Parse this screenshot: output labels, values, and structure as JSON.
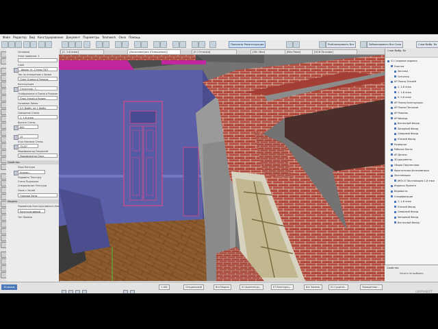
{
  "menu": [
    "Файл",
    "Редактор",
    "Вид",
    "Конструирование",
    "Документ",
    "Параметры",
    "Teamwork",
    "Окно",
    "Помощь"
  ],
  "toolbar": {
    "renovation_button": "Просмотр Реконструкции",
    "publish_button": "Разблокировать Все",
    "layer_button": "Заблокировать Все Слои",
    "find_select_button": "Слои Выбр. Бл"
  },
  "tabs": [
    {
      "label": "[1. 1-й этаж]",
      "active": false
    },
    {
      "label": "[Аксонометрия (Освещение)]",
      "active": true
    },
    {
      "label": "[0 / Отточка]",
      "active": false
    },
    {
      "label": "[3D / Все]",
      "active": false
    },
    {
      "label": "[Без Пола]",
      "active": false
    },
    {
      "label": "[ОСК Потолок]",
      "active": false
    }
  ],
  "infobox": {
    "sections": [
      {
        "label": "Геометрия"
      },
      {
        "label": "Свойства"
      },
      {
        "label": "Поверхности"
      },
      {
        "label": "Модель"
      }
    ],
    "labels": [
      "Основная",
      "Этаж привязки: 1",
      "Слой",
      "Тип по отношению к Зонам",
      "Конструкция",
      "Отображение в Плане и Разрезе",
      "Основная Линия",
      "Смещение Стены",
      "Высота Стены",
      "Угол Наклона Стены",
      "Модификатор Покрытий",
      "Перо Контура",
      "Поверхности",
      "Слой Ландшафт",
      "Параметры Конструктивного Анализа",
      "Тип Проема"
    ],
    "fields": [
      "",
      "_Фасад_Ог..Стены ГКЛ",
      "План Отдела в Разрезе",
      "Кирпичная Кладка",
      "Структура - Г..",
      "План Этажа и Разрез",
      "0.5 Дюйм. на 1 Дюйм.",
      "1. 1-й этаж",
      "800",
      "15",
      "75,00°",
      "Модификатор Покр.",
      "Кирпич...",
      "Граница Зоны",
      "Конструктивный"
    ],
    "checkbox_labels": [
      "Подавить Текстуру",
      "Стена Подложки",
      "Специальные Текстуры",
      "Связь с Зоной"
    ]
  },
  "navigator": {
    "title": "Слои Выбр. Бл",
    "items": [
      {
        "label": "01 Создание издания",
        "indent": 0
      },
      {
        "label": "Участки",
        "indent": 1
      },
      {
        "label": "Зонтики",
        "indent": 2
      },
      {
        "label": "Сетчатая",
        "indent": 2
      },
      {
        "label": "АР Планы Этажей",
        "indent": 1
      },
      {
        "label": "2. 2-й этаж",
        "indent": 2
      },
      {
        "label": "1. 1-й этаж",
        "indent": 2
      },
      {
        "label": "0. 0-й этаж",
        "indent": 2
      },
      {
        "label": "АР Планы Конструкции",
        "indent": 1
      },
      {
        "label": "АР Планы Потолков",
        "indent": 1
      },
      {
        "label": "АР Разрезы",
        "indent": 1
      },
      {
        "label": "АР Фасады",
        "indent": 1
      },
      {
        "label": "Восточный Фасад",
        "indent": 2
      },
      {
        "label": "Западный Фасад",
        "indent": 2
      },
      {
        "label": "Северный Фасад",
        "indent": 2
      },
      {
        "label": "Южный Фасад",
        "indent": 2
      },
      {
        "label": "Развертки",
        "indent": 1
      },
      {
        "label": "Рабочие Листы",
        "indent": 1
      },
      {
        "label": "АР Детали",
        "indent": 1
      },
      {
        "label": "3D-документы",
        "indent": 1
      },
      {
        "label": "Общая Перспектива",
        "indent": 1
      },
      {
        "label": "Фронтальная Аксонометрия",
        "indent": 1
      },
      {
        "label": "Экспликации",
        "indent": 1
      },
      {
        "label": "ИКЭ-07 Экспликация 1-й этаж",
        "indent": 2
      },
      {
        "label": "Индексы Проекта",
        "indent": 1
      },
      {
        "label": "Ведомости",
        "indent": 1
      },
      {
        "label": "Спецификации",
        "indent": 1
      },
      {
        "label": "1. 1-й этаж",
        "indent": 2
      },
      {
        "label": "Южный Фасад",
        "indent": 2
      },
      {
        "label": "Северный Фасад",
        "indent": 2
      },
      {
        "label": "Западный Фасад",
        "indent": 2
      },
      {
        "label": "Восточный Фасад",
        "indent": 2
      }
    ]
  },
  "properties": {
    "title": "Свойства",
    "message": "Ничего не выбрано."
  },
  "statusbar": {
    "model_tab": "3D-вызов",
    "items": [
      "1:100",
      "Специальный",
      "Вся Модель",
      "01 Архитектур...",
      "07 Конструкц...",
      "Без Замены",
      "01 Существ...",
      "Упрощенные ..."
    ],
    "watermark": "GRAPHISOFT"
  },
  "colors": {
    "brick": "#b24a3c",
    "wall_blue": "#5b5fa8",
    "floor_wood": "#8a5a2e",
    "accent": "#4a78b8"
  }
}
